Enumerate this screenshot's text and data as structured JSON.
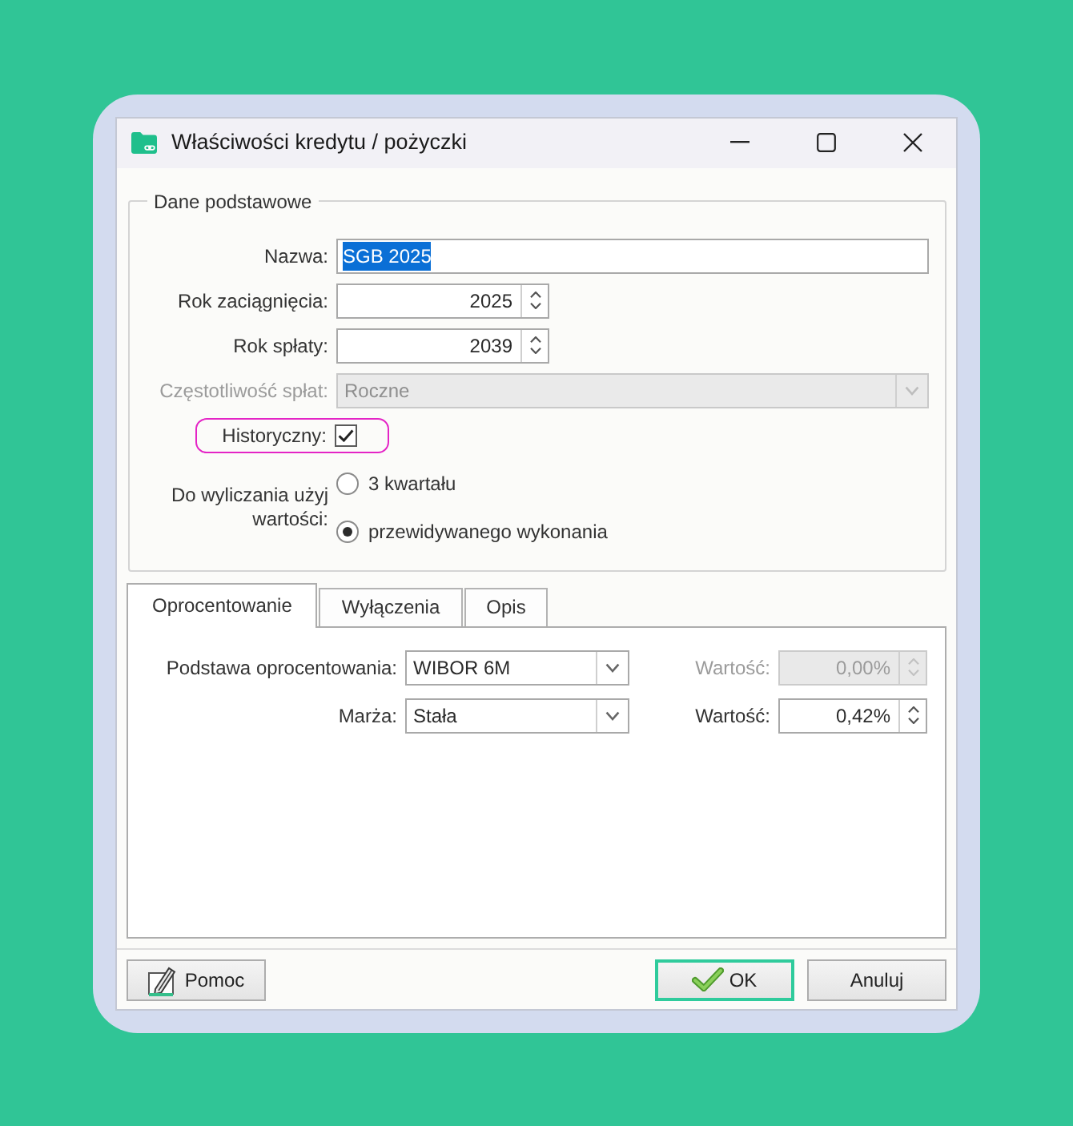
{
  "window": {
    "title": "Właściwości kredytu / pożyczki"
  },
  "basic_data": {
    "title": "Dane podstawowe",
    "fields": [
      {
        "kind": "text",
        "label": "Nazwa:",
        "value": "SGB 2025",
        "text_selected": true,
        "disabled": false,
        "highlighted": false
      },
      {
        "kind": "spin",
        "label": "Rok zaciągnięcia:",
        "value": "2025",
        "disabled": false,
        "highlighted": false
      },
      {
        "kind": "spin",
        "label": "Rok spłaty:",
        "value": "2039",
        "disabled": false,
        "highlighted": false
      },
      {
        "kind": "select",
        "label": "Częstotliwość spłat:",
        "value": "Roczne",
        "disabled": true,
        "highlighted": false
      },
      {
        "kind": "checkbox",
        "label": "Historyczny:",
        "checked": true,
        "disabled": false,
        "highlighted": true
      }
    ],
    "value_choice": {
      "label": "Do wyliczania użyj wartości:",
      "options": [
        {
          "label": "3 kwartału",
          "selected": false
        },
        {
          "label": "przewidywanego wykonania",
          "selected": true
        }
      ]
    }
  },
  "tabs": [
    {
      "label": "Oprocentowanie",
      "selected": true
    },
    {
      "label": "Wyłączenia",
      "selected": false
    },
    {
      "label": "Opis",
      "selected": false
    }
  ],
  "interest": {
    "rows": [
      {
        "label": "Podstawa oprocentowania:",
        "value": "WIBOR 6M",
        "amount_label": "Wartość:",
        "amount": "0,00%",
        "amount_disabled": true
      },
      {
        "label": "Marża:",
        "value": "Stała",
        "amount_label": "Wartość:",
        "amount": "0,42%",
        "amount_disabled": false
      }
    ]
  },
  "buttons": [
    {
      "kind": "help",
      "label": "Pomoc",
      "focused": false
    },
    {
      "kind": "ok",
      "label": "OK",
      "focused": true
    },
    {
      "kind": "cancel",
      "label": "Anuluj",
      "focused": false
    }
  ]
}
